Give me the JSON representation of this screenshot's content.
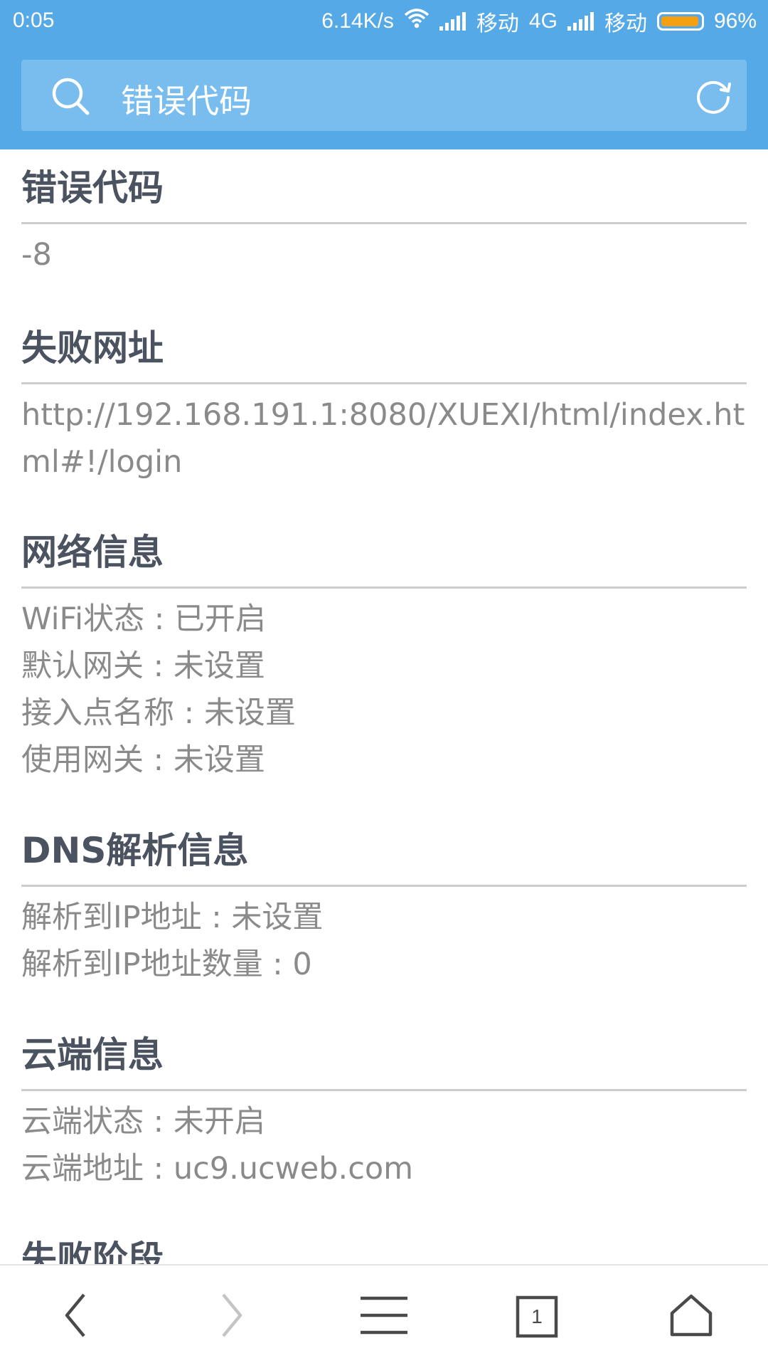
{
  "status_bar": {
    "time": "0:05",
    "net_speed": "6.14K/s",
    "carrier1": "移动",
    "network_type": "4G",
    "carrier2": "移动",
    "battery_text": "96%",
    "battery_level": 0.96,
    "icons": [
      "wifi-icon",
      "signal-icon",
      "battery-icon"
    ]
  },
  "address_bar": {
    "text": "错误代码",
    "icons": [
      "search-icon",
      "refresh-icon"
    ]
  },
  "sections": [
    {
      "title": "错误代码",
      "lines": [
        "-8"
      ]
    },
    {
      "title": "失败网址",
      "lines": [
        "http://192.168.191.1:8080/XUEXI/html/index.html#!/login"
      ]
    },
    {
      "title": "网络信息",
      "lines": [
        "WiFi状态 : 已开启",
        "默认网关 : 未设置",
        "接入点名称 : 未设置",
        "使用网关 : 未设置"
      ]
    },
    {
      "title": "DNS解析信息",
      "lines": [
        "解析到IP地址 : 未设置",
        "解析到IP地址数量 : 0"
      ]
    },
    {
      "title": "云端信息",
      "lines": [
        "云端状态 : 未开启",
        "云端地址 : uc9.ucweb.com"
      ]
    },
    {
      "title": "失败阶段",
      "lines": []
    }
  ],
  "bottom_nav": {
    "tab_count": "1",
    "icons": [
      "back-icon",
      "forward-icon",
      "menu-icon",
      "tabs-icon",
      "home-icon"
    ]
  },
  "colors": {
    "accent": "#55a9e6",
    "search_box": "#78bdee",
    "title_text": "#4c5360",
    "body_text": "#8a8a8a",
    "battery": "#f5a011"
  }
}
